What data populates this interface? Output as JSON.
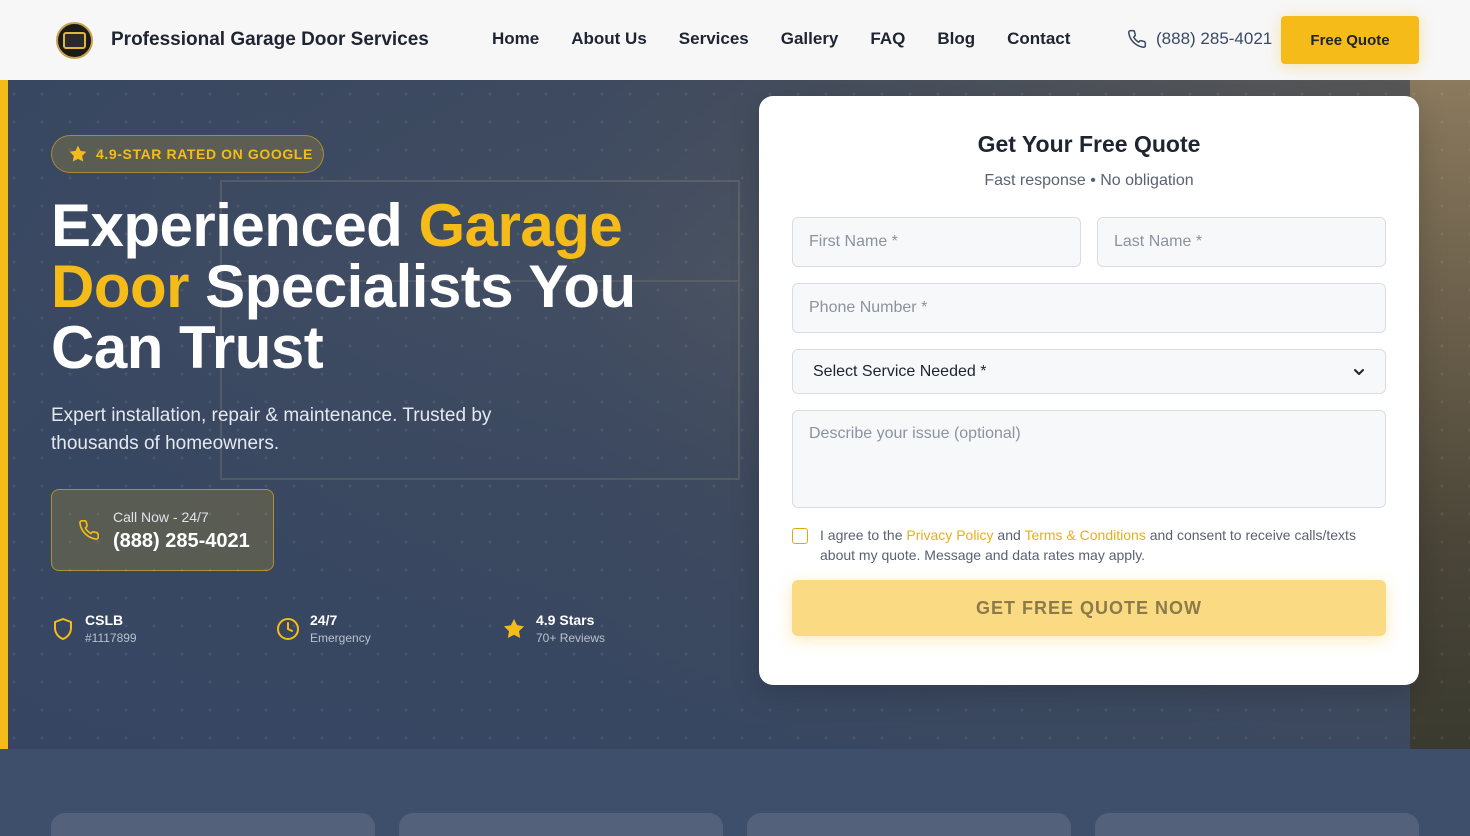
{
  "header": {
    "brand": "Professional Garage Door Services",
    "nav": [
      "Home",
      "About Us",
      "Services",
      "Gallery",
      "FAQ",
      "Blog",
      "Contact"
    ],
    "phone": "(888) 285-4021",
    "quote_button": "Free Quote"
  },
  "hero": {
    "badge": "4.9-STAR RATED ON GOOGLE",
    "headline": {
      "part1": "Experienced ",
      "highlight1": "Garage",
      "highlight2": "Door",
      "part2": " Specialists You Can Trust"
    },
    "subhead": "Expert installation, repair & maintenance. Trusted by thousands of homeowners.",
    "call": {
      "label": "Call Now - 24/7",
      "number": "(888) 285-4021"
    },
    "stats": [
      {
        "title": "CSLB",
        "sub": "#1117899",
        "icon": "shield-icon"
      },
      {
        "title": "24/7",
        "sub": "Emergency",
        "icon": "clock-icon"
      },
      {
        "title": "4.9 Stars",
        "sub": "70+ Reviews",
        "icon": "star-icon"
      }
    ]
  },
  "form": {
    "title": "Get Your Free Quote",
    "subtitle": "Fast response • No obligation",
    "first_name_placeholder": "First Name *",
    "last_name_placeholder": "Last Name *",
    "phone_placeholder": "Phone Number *",
    "service_selected": "Select Service Needed *",
    "issue_placeholder": "Describe your issue (optional)",
    "agree": {
      "prefix": "I agree to the ",
      "privacy": "Privacy Policy",
      "and": " and ",
      "terms": "Terms & Conditions",
      "suffix": " and consent to receive calls/texts about my quote. Message and data rates may apply."
    },
    "submit": "GET FREE QUOTE NOW"
  },
  "colors": {
    "accent": "#f5bb18",
    "dark": "#1e2430",
    "hero_bg": "#3d4f6b"
  }
}
